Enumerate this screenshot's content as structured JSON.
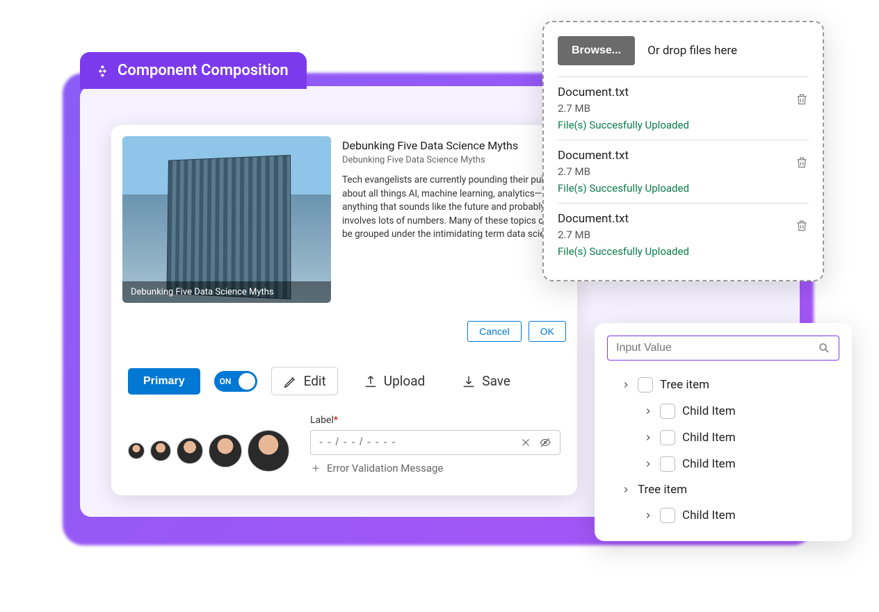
{
  "header": {
    "title": "Component Composition"
  },
  "article": {
    "image_caption": "Debunking Five Data Science Myths",
    "title": "Debunking Five Data Science Myths",
    "subtitle": "Debunking Five Data Science Myths",
    "body": "Tech evangelists are currently pounding their pulpits about all things AI, machine learning, analytics—anything that sounds like the future and probably involves lots of numbers. Many of these topics can be grouped under the intimidating term data science.",
    "cancel": "Cancel",
    "ok": "OK"
  },
  "toolbar": {
    "primary": "Primary",
    "toggle": "ON",
    "edit": "Edit",
    "upload": "Upload",
    "save": "Save"
  },
  "form": {
    "label": "Label",
    "required": "*",
    "placeholder": "- - / - - / - - - -",
    "validation": "Error Validation Message"
  },
  "upload": {
    "browse": "Browse...",
    "drop_text": "Or drop files here",
    "files": [
      {
        "name": "Document.txt",
        "size": "2.7 MB",
        "status": "File(s) Succesfully Uploaded"
      },
      {
        "name": "Document.txt",
        "size": "2.7 MB",
        "status": "File(s) Succesfully Uploaded"
      },
      {
        "name": "Document.txt",
        "size": "2.7 MB",
        "status": "File(s) Succesfully Uploaded"
      }
    ]
  },
  "tree": {
    "search_placeholder": "Input Value",
    "items": [
      {
        "level": 0,
        "label": "Tree item",
        "checkbox": true,
        "chevron": true
      },
      {
        "level": 1,
        "label": "Child Item",
        "checkbox": true,
        "chevron": true
      },
      {
        "level": 1,
        "label": "Child Item",
        "checkbox": true,
        "chevron": true
      },
      {
        "level": 1,
        "label": "Child Item",
        "checkbox": true,
        "chevron": true
      },
      {
        "level": 0,
        "label": "Tree item",
        "checkbox": false,
        "chevron": true
      },
      {
        "level": 1,
        "label": "Child Item",
        "checkbox": true,
        "chevron": true
      }
    ]
  },
  "colors": {
    "accent_purple": "#7c3aed",
    "accent_blue": "#0078d4",
    "success_green": "#0a7a4a"
  }
}
